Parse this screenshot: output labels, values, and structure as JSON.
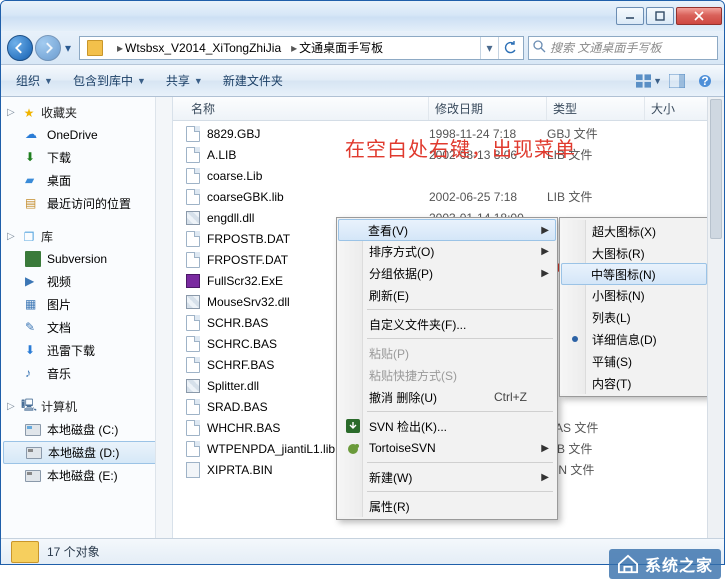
{
  "window": {
    "breadcrumb_seg1": "Wtsbsx_V2014_XiTongZhiJia",
    "breadcrumb_seg2": "文通桌面手写板",
    "search_placeholder": "搜索 文通桌面手写板"
  },
  "toolbar": {
    "organize": "组织",
    "include": "包含到库中",
    "share": "共享",
    "newfolder": "新建文件夹"
  },
  "nav": {
    "favorites": "收藏夹",
    "onedrive": "OneDrive",
    "downloads": "下载",
    "desktop": "桌面",
    "recent": "最近访问的位置",
    "libraries": "库",
    "subversion": "Subversion",
    "videos": "视频",
    "pictures": "图片",
    "documents": "文档",
    "xunlei": "迅雷下载",
    "music": "音乐",
    "computer": "计算机",
    "drive_c": "本地磁盘 (C:)",
    "drive_d": "本地磁盘 (D:)",
    "drive_e": "本地磁盘 (E:)"
  },
  "cols": {
    "name": "名称",
    "date": "修改日期",
    "type": "类型",
    "size": "大小"
  },
  "annotation": "在空白处右键，出现菜单",
  "files": [
    {
      "name": "8829.GBJ",
      "date": "1998-11-24 7:18",
      "type": "GBJ 文件",
      "icon": "file"
    },
    {
      "name": "A.LIB",
      "date": "2002-08-13 8:06",
      "type": "LIB 文件",
      "icon": "file"
    },
    {
      "name": "coarse.Lib",
      "date": "",
      "type": "",
      "icon": "file"
    },
    {
      "name": "coarseGBK.lib",
      "date": "2002-06-25 7:18",
      "type": "LIB 文件",
      "icon": "file"
    },
    {
      "name": "engdll.dll",
      "date": "2003-01-14 18:00",
      "type": "",
      "icon": "dll"
    },
    {
      "name": "FRPOSTB.DAT",
      "date": "",
      "type": "",
      "icon": "file"
    },
    {
      "name": "FRPOSTF.DAT",
      "date": "",
      "type": "",
      "icon": "file"
    },
    {
      "name": "FullScr32.ExE",
      "date": "",
      "type": "",
      "icon": "exe"
    },
    {
      "name": "MouseSrv32.dll",
      "date": "",
      "type": "",
      "icon": "dll"
    },
    {
      "name": "SCHR.BAS",
      "date": "",
      "type": "",
      "icon": "file"
    },
    {
      "name": "SCHRC.BAS",
      "date": "",
      "type": "",
      "icon": "file"
    },
    {
      "name": "SCHRF.BAS",
      "date": "",
      "type": "",
      "icon": "file"
    },
    {
      "name": "Splitter.dll",
      "date": "",
      "type": "",
      "icon": "dll"
    },
    {
      "name": "SRAD.BAS",
      "date": "",
      "type": "",
      "icon": "file"
    },
    {
      "name": "WHCHR.BAS",
      "date": "",
      "type": "BAS 文件",
      "icon": "file"
    },
    {
      "name": "WTPENPDA_jiantiL1.lib",
      "date": "",
      "type": "LIB 文件",
      "icon": "file"
    },
    {
      "name": "XIPRTA.BIN",
      "date": "",
      "type": "BIN 文件",
      "icon": "bin"
    }
  ],
  "ctx1": {
    "view": "查看(V)",
    "sort": "排序方式(O)",
    "group": "分组依据(P)",
    "refresh": "刷新(E)",
    "customize": "自定义文件夹(F)...",
    "paste": "粘贴(P)",
    "paste_shortcut": "粘贴快捷方式(S)",
    "undo_delete": "撤消 删除(U)",
    "undo_key": "Ctrl+Z",
    "svn_checkout": "SVN 检出(K)...",
    "tortoise": "TortoiseSVN",
    "new": "新建(W)",
    "properties": "属性(R)"
  },
  "ctx2": {
    "xl_icon": "超大图标(X)",
    "l_icon": "大图标(R)",
    "m_icon": "中等图标(N)",
    "s_icon": "小图标(N)",
    "list": "列表(L)",
    "details": "详细信息(D)",
    "tiles": "平铺(S)",
    "content": "内容(T)"
  },
  "status": {
    "count": "17 个对象"
  },
  "watermark": "系统之家"
}
